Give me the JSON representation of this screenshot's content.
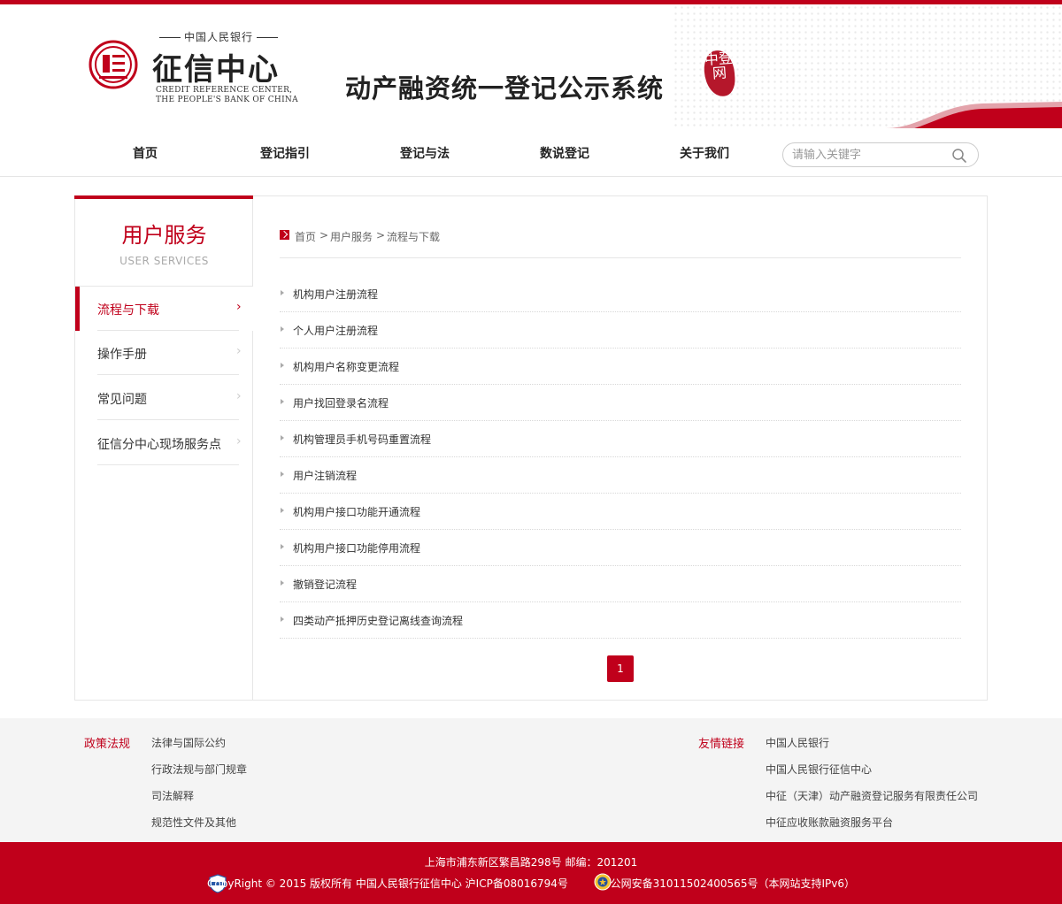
{
  "header": {
    "logo_top": "中国人民银行",
    "logo_main": "征信中心",
    "logo_en_line1": "CREDIT REFERENCE CENTER,",
    "logo_en_line2": "THE PEOPLE'S BANK OF CHINA",
    "system_title": "动产融资统一登记公示系统",
    "seal_text": "中登网"
  },
  "nav": {
    "items": [
      {
        "label": "首页"
      },
      {
        "label": "登记指引"
      },
      {
        "label": "登记与法"
      },
      {
        "label": "数说登记"
      },
      {
        "label": "关于我们"
      }
    ],
    "search_placeholder": "请输入关键字"
  },
  "sidebar": {
    "title": "用户服务",
    "subtitle": "USER SERVICES",
    "items": [
      {
        "label": "流程与下载",
        "active": true
      },
      {
        "label": "操作手册"
      },
      {
        "label": "常见问题"
      },
      {
        "label": "征信分中心现场服务点"
      }
    ]
  },
  "breadcrumb": {
    "home": "首页",
    "sep": ">",
    "section": "用户服务",
    "current": "流程与下载"
  },
  "list": [
    "机构用户注册流程",
    "个人用户注册流程",
    "机构用户名称变更流程",
    "用户找回登录名流程",
    "机构管理员手机号码重置流程",
    "用户注销流程",
    "机构用户接口功能开通流程",
    "机构用户接口功能停用流程",
    "撤销登记流程",
    "四类动产抵押历史登记离线查询流程"
  ],
  "pagination": {
    "current": "1"
  },
  "footer": {
    "policy_heading": "政策法规",
    "policy_links": [
      "法律与国际公约",
      "行政法规与部门规章",
      "司法解释",
      "规范性文件及其他"
    ],
    "friend_heading": "友情链接",
    "friend_links": [
      "中国人民银行",
      "中国人民银行征信中心",
      "中征（天津）动产融资登记服务有限责任公司",
      "中征应收账款融资服务平台"
    ],
    "address": "上海市浦东新区繁昌路298号 邮编：201201",
    "copyright": "CopyRight © 2015 版权所有 中国人民银行征信中心 沪ICP备08016794号",
    "security": "沪公网安备31011502400565号（本网站支持IPv6）"
  },
  "colors": {
    "brand": "#c0001b"
  },
  "icons": [
    "credit-center-emblem-icon",
    "search-icon",
    "breadcrumb-arrow-icon",
    "chevron-right-icon",
    "triangle-bullet-icon",
    "security-badge-icon",
    "police-emblem-icon"
  ]
}
